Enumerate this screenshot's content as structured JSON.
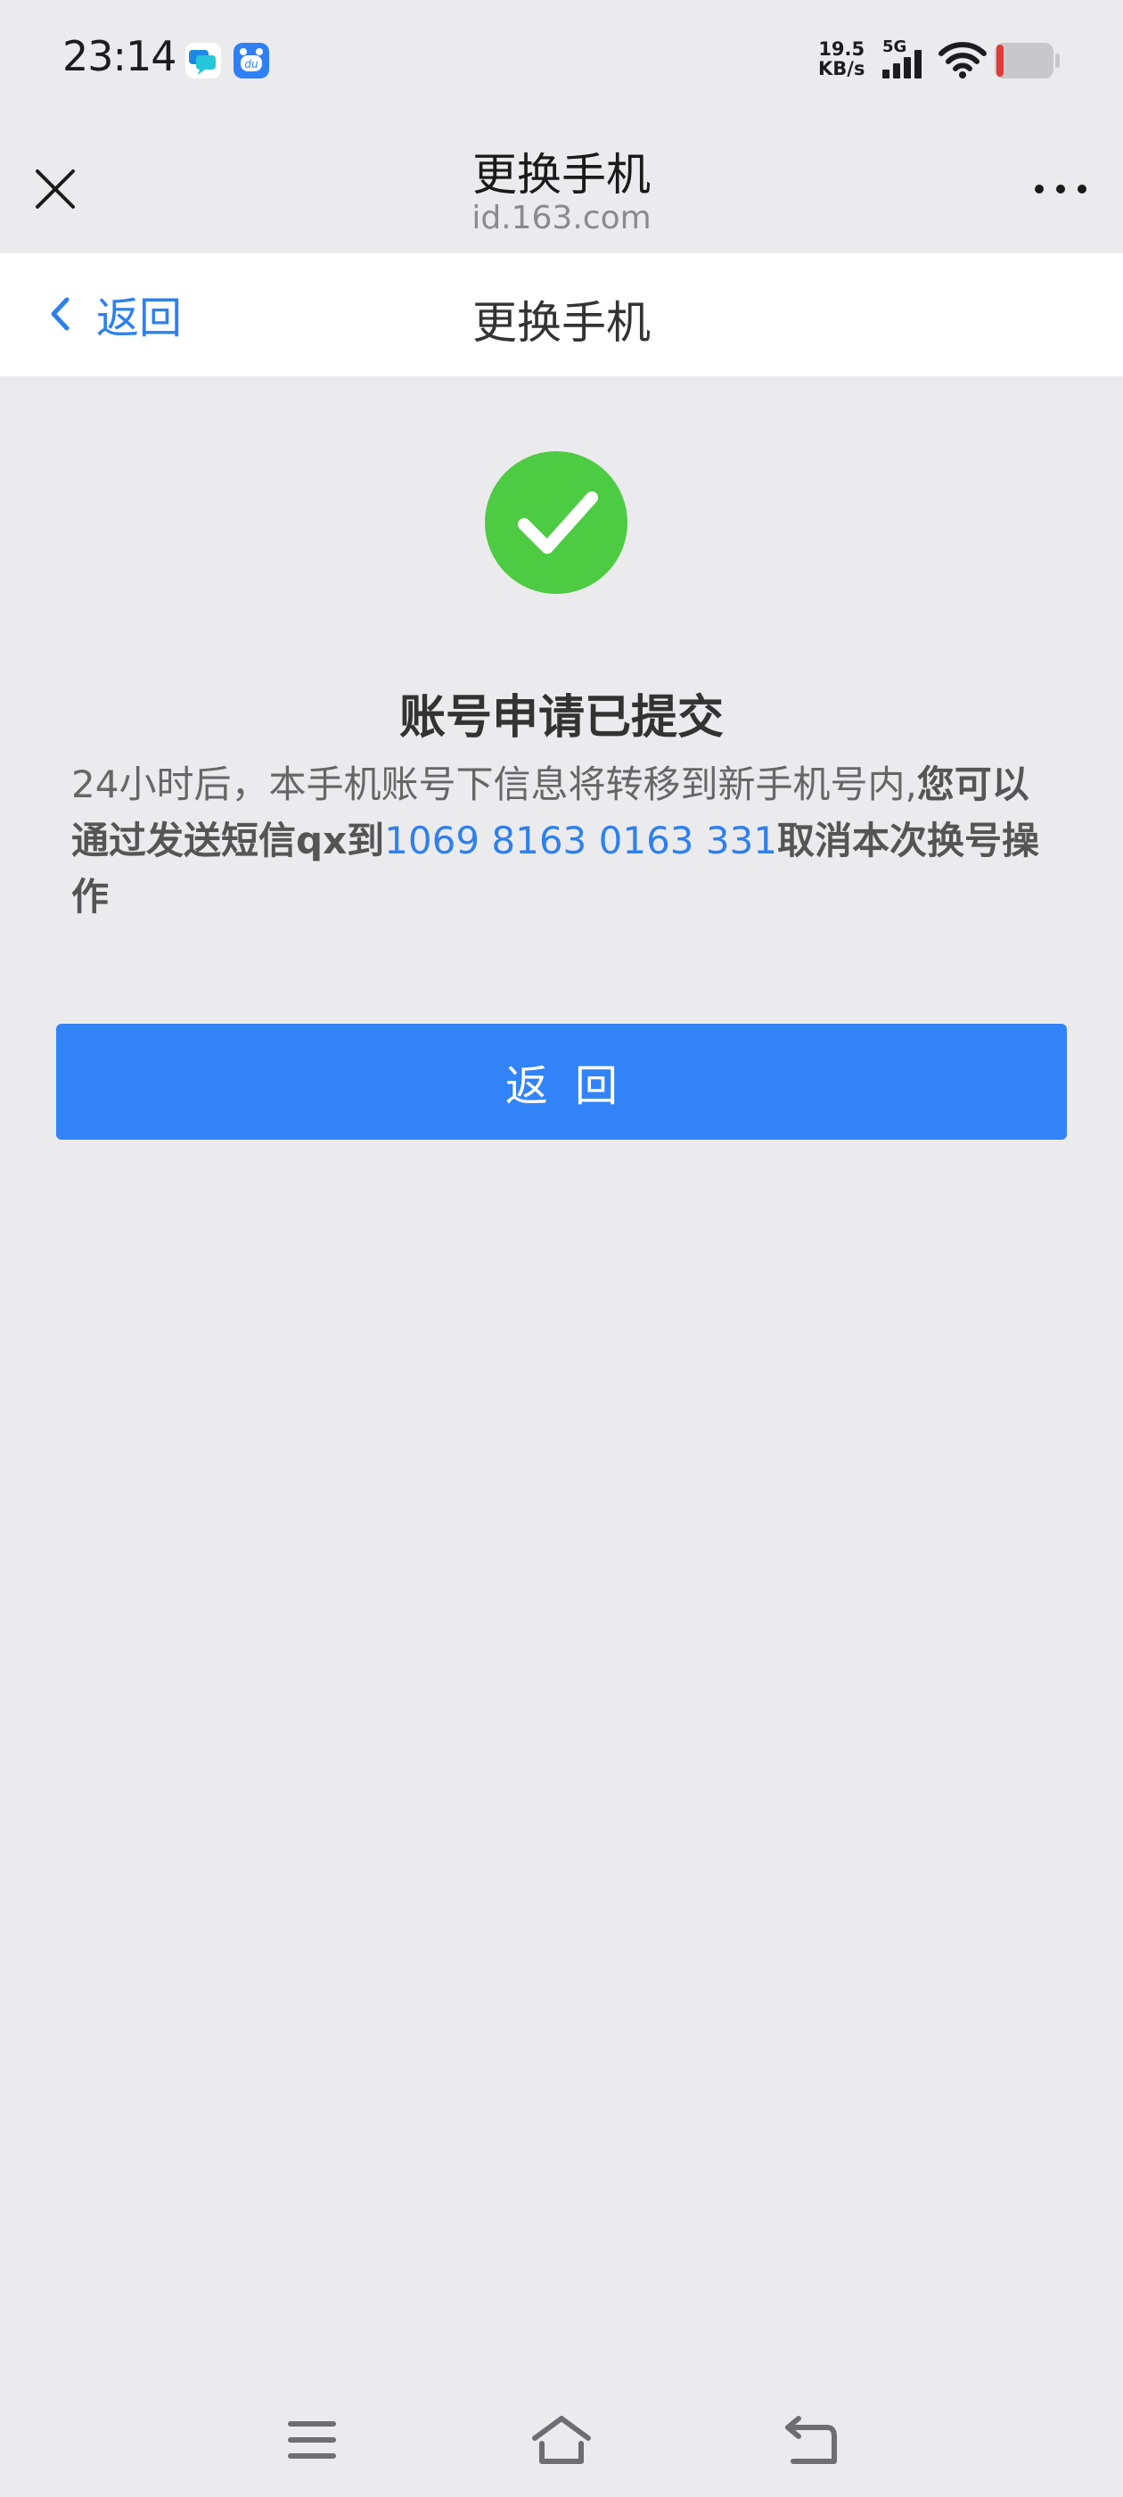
{
  "status_bar": {
    "time": "23:14",
    "net_speed_value": "19.5",
    "net_speed_unit": "KB/s",
    "network_type": "5G",
    "icons": [
      "messages-app-icon",
      "baidu-app-icon",
      "signal-icon",
      "wifi-icon",
      "battery-icon"
    ],
    "battery_color": "#E53935"
  },
  "browser_header": {
    "title": "更换手机",
    "domain": "id.163.com",
    "close_icon": "close-icon",
    "more_icon": "more-icon"
  },
  "page_nav": {
    "back_label": "返回",
    "title": "更换手机"
  },
  "result": {
    "title": "账号申请已提交",
    "desc_part1": "24小时后，本手机账号下信息将转移到新手机号内,",
    "desc_bold1": "您可以通过发送短信qx到",
    "phone_number": "1069 8163 0163 331",
    "desc_bold2": "取消本次换号操作",
    "success_color": "#4CCB43"
  },
  "primary_button": {
    "label": "返回"
  },
  "system_nav": {
    "buttons": [
      "menu-icon",
      "home-icon",
      "back-icon"
    ]
  },
  "colors": {
    "background": "#EBEBED",
    "accent": "#2F80ED",
    "button": "#3183F7"
  }
}
